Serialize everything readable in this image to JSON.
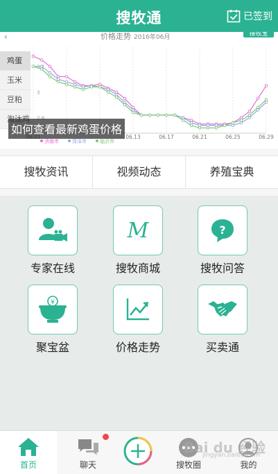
{
  "header": {
    "title": "搜牧通",
    "signin_label": "已签到"
  },
  "chart_header": {
    "title": "价格走势",
    "date": "2016年06月",
    "button": "搜牧宝"
  },
  "categories": [
    "鸡蛋",
    "玉米",
    "豆粕",
    "淘汰鸡"
  ],
  "chart_data": {
    "type": "line",
    "x": [
      "06.01",
      "06.05",
      "06.09",
      "06.13",
      "06.17",
      "06.21",
      "06.25",
      "06.29"
    ],
    "x_ticks": [
      "06.01",
      "06.13",
      "06.17",
      "06.21",
      "06.25",
      "06.29"
    ],
    "y_ticks": [
      "3.2",
      "3",
      "2.8"
    ],
    "series": [
      {
        "name": "济南市",
        "color": "#e06fd2",
        "values": [
          3.28,
          3.25,
          3.2,
          3.12,
          3.12,
          3.08,
          3.05,
          3.05,
          3.06,
          3.03,
          3.0,
          2.95,
          2.88,
          2.82,
          2.82,
          2.82,
          2.82,
          2.82,
          2.8,
          2.78,
          2.75,
          2.75,
          2.75,
          2.75,
          2.76,
          2.8,
          2.85,
          2.95,
          3.05
        ]
      },
      {
        "name": "菏泽市",
        "color": "#8fa7e0",
        "values": [
          3.2,
          3.2,
          3.15,
          3.1,
          3.08,
          3.06,
          3.04,
          3.05,
          3.04,
          3.02,
          2.98,
          2.92,
          2.86,
          2.82,
          2.82,
          2.82,
          2.82,
          2.82,
          2.8,
          2.76,
          2.74,
          2.74,
          2.74,
          2.74,
          2.74,
          2.76,
          2.8,
          2.86,
          2.92
        ]
      },
      {
        "name": "临沂市",
        "color": "#7cc576",
        "values": [
          3.2,
          3.18,
          3.12,
          3.08,
          3.06,
          3.04,
          3.02,
          3.04,
          3.04,
          3.0,
          2.96,
          2.9,
          2.84,
          2.82,
          2.82,
          2.82,
          2.82,
          2.82,
          2.78,
          2.74,
          2.72,
          2.72,
          2.72,
          2.74,
          2.76,
          2.78,
          2.82,
          2.88,
          2.94
        ]
      }
    ],
    "ylim": [
      2.7,
      3.35
    ]
  },
  "overlay_text": "如何查看最新鸡蛋价格",
  "tabs": [
    "搜牧资讯",
    "视频动态",
    "养殖宝典"
  ],
  "grid_items": [
    "专家在线",
    "搜牧商城",
    "搜牧问答",
    "聚宝盆",
    "价格走势",
    "买卖通"
  ],
  "tabbar": [
    "首页",
    "聊天",
    "搜牧圈",
    "我的"
  ],
  "watermark": "Bai du 经验",
  "watermark_sub": "jingyan.baidu.com",
  "colors": {
    "accent": "#2bb292",
    "badge": "#f04747"
  }
}
